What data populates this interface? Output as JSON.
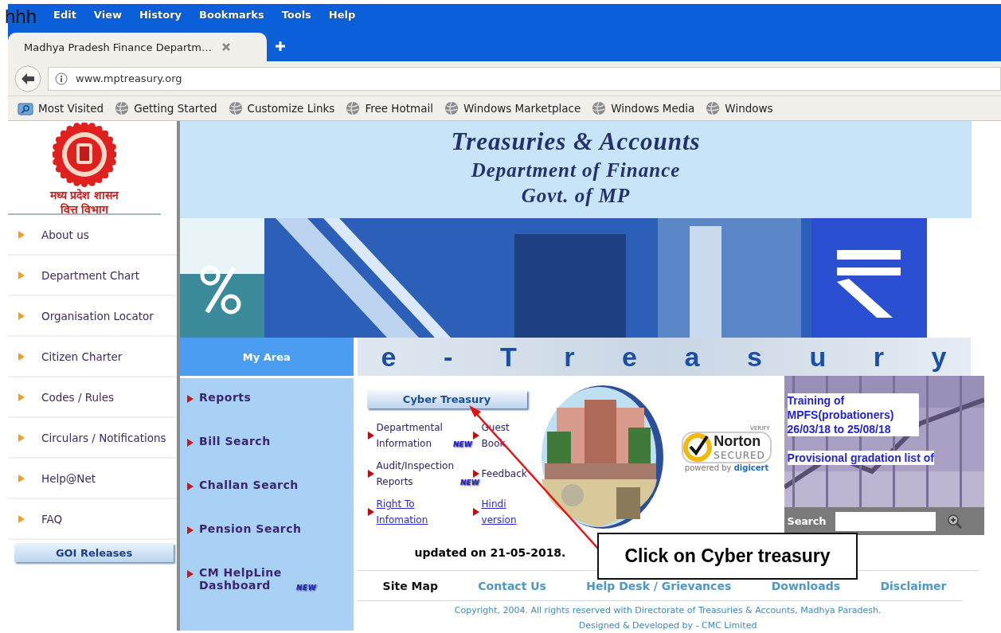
{
  "overlay_text": "hhh",
  "menu": [
    "Edit",
    "View",
    "History",
    "Bookmarks",
    "Tools",
    "Help"
  ],
  "tab": {
    "title": "Madhya Pradesh Finance Departm…",
    "selected": true
  },
  "address": "www.mptreasury.org",
  "bookmarks": [
    {
      "label": "Most Visited",
      "kind": "folder"
    },
    {
      "label": "Getting Started",
      "kind": "globe"
    },
    {
      "label": "Customize Links",
      "kind": "globe"
    },
    {
      "label": "Free Hotmail",
      "kind": "globe"
    },
    {
      "label": "Windows Marketplace",
      "kind": "globe"
    },
    {
      "label": "Windows Media",
      "kind": "globe"
    },
    {
      "label": "Windows",
      "kind": "globe"
    }
  ],
  "logo_lines": [
    "मध्य प्रदेश शासन",
    "वित्त विभाग"
  ],
  "sidebar": {
    "items": [
      "About us",
      "Department Chart",
      "Organisation Locator",
      "Citizen Charter",
      "Codes / Rules",
      "Circulars / Notifications",
      "Help@Net",
      "FAQ"
    ],
    "button": "GOI Releases"
  },
  "header": {
    "lines": [
      "Treasuries & Accounts",
      "Department of Finance",
      "Govt. of MP"
    ]
  },
  "my_area": {
    "title": "My Area",
    "items": [
      {
        "label": "Reports"
      },
      {
        "label": "Bill Search"
      },
      {
        "label": "Challan Search"
      },
      {
        "label": "Pension Search"
      },
      {
        "label": "CM HelpLine Dashboard",
        "badge": "NEW"
      }
    ]
  },
  "e_treasury": [
    "e",
    "-",
    "T",
    "r",
    "e",
    "a",
    "s",
    "u",
    "r",
    "y"
  ],
  "cyber_button": "Cyber Treasury",
  "links": [
    {
      "label": "Departmental Information",
      "badge": "NEW",
      "underlined": false
    },
    {
      "label": "Guest Book",
      "underlined": false
    },
    {
      "label": "Audit/Inspection Reports",
      "badge": "NEW",
      "underlined": false
    },
    {
      "label": "Feedback",
      "underlined": false
    },
    {
      "label": "Right To Infomation",
      "underlined": true
    },
    {
      "label": "Hindi version",
      "underlined": true
    }
  ],
  "norton": {
    "verify": "VERIFY",
    "name": "Norton",
    "secured": "SECURED",
    "powered": "powered by",
    "brand": "digicert"
  },
  "news": [
    "Training of MPFS(probationers) 26/03/18 to 25/08/18",
    "Provisional gradation list of"
  ],
  "search": {
    "label": "Search"
  },
  "updated": "updated on 21-05-2018.",
  "footer_links": [
    {
      "label": "Site Map",
      "kind": "plain"
    },
    {
      "label": "Contact Us",
      "kind": "link"
    },
    {
      "label": "Help Desk / Grievances",
      "kind": "link"
    },
    {
      "label": "Downloads",
      "kind": "link"
    },
    {
      "label": "Disclaimer",
      "kind": "link"
    }
  ],
  "copyright": [
    "Copyright, 2004. All rights reserved with Directorate of Treasuries & Accounts, Madhya Paradesh.",
    "Designed & Developed by - CMC Limited"
  ],
  "callout": "Click on Cyber treasury"
}
